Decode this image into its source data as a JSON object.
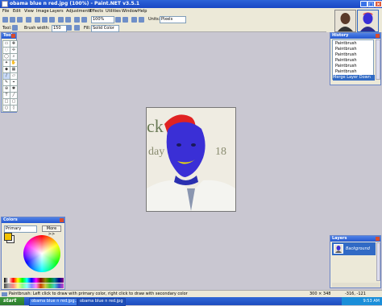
{
  "window": {
    "title": "obama blue n red.jpg (100%) - Paint.NET v3.5.1"
  },
  "menu": [
    "File",
    "Edit",
    "View",
    "Image",
    "Layers",
    "Adjustments",
    "Effects",
    "Utilities",
    "Window",
    "Help"
  ],
  "toolbar": {
    "zoom_value": "100%",
    "units_label": "Units:",
    "units_value": "Pixels"
  },
  "tool_options": {
    "tool_label": "Tool:",
    "brush_width_label": "Brush width:",
    "brush_width_value": "150",
    "fill_label": "Fill:",
    "fill_value": "Solid Color"
  },
  "tools_panel": {
    "title": "Tools"
  },
  "history_panel": {
    "title": "History",
    "items": [
      {
        "label": "Paintbrush"
      },
      {
        "label": "Paintbrush"
      },
      {
        "label": "Paintbrush"
      },
      {
        "label": "Paintbrush"
      },
      {
        "label": "Paintbrush"
      },
      {
        "label": "Paintbrush"
      },
      {
        "label": "Merge Layer Down"
      }
    ]
  },
  "colors_panel": {
    "title": "Colors",
    "mode_value": "Primary",
    "more_label": "More >>"
  },
  "layers_panel": {
    "title": "Layers",
    "layer_name": "Background"
  },
  "statusbar": {
    "hint": "Paintbrush: Left click to draw with primary color, right click to draw with secondary color",
    "image_size": "300 × 348",
    "cursor_pos": "-316, -121"
  },
  "taskbar": {
    "start_label": "start",
    "task1": "obama blue n red.jpg...",
    "task2": "obama blue n red.jpg",
    "clock": "9:53 AM"
  },
  "colors": {
    "primary": "#f2c200",
    "secondary": "#ffffff",
    "face_blue": "#3a2fd6",
    "hair_red": "#e02222"
  }
}
